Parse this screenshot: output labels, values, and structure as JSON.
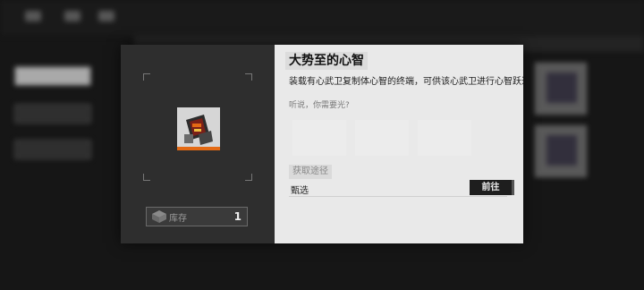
{
  "dialog": {
    "title": "大势至的心智",
    "description": "装载有心武卫复制体心智的终端，可供该心武卫进行心智跃迁。",
    "flavor_text": "听说，你需要光?",
    "acquire_route_label": "获取途径",
    "route_name": "甄选",
    "go_button_label": "前往",
    "stock_label": "库存",
    "stock_count": "1"
  },
  "colors": {
    "accent_orange": "#e46a14",
    "left_pane_bg": "#2e2e2e",
    "right_pane_bg": "#e9e9e9",
    "go_button_bg": "#1e1e1e"
  },
  "icons": {
    "item": "terminal-chip-icon",
    "stock": "box-icon"
  }
}
